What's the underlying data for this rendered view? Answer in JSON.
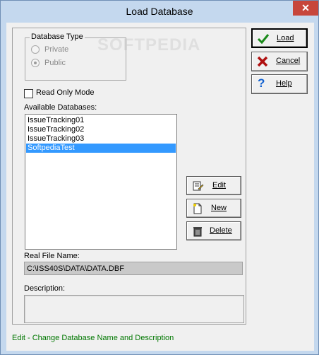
{
  "window": {
    "title": "Load Database",
    "close_glyph": "✕"
  },
  "watermark": "SOFTPEDIA",
  "db_type": {
    "legend": "Database Type",
    "options": [
      {
        "label": "Private",
        "selected": false
      },
      {
        "label": "Public",
        "selected": true
      }
    ]
  },
  "read_only": {
    "label": "Read Only Mode",
    "checked": false
  },
  "available": {
    "label": "Available Databases:",
    "items": [
      "IssueTracking01",
      "IssueTracking02",
      "IssueTracking03",
      "SoftpediaTest"
    ],
    "selected_index": 3
  },
  "side_buttons": {
    "edit": "Edit",
    "new": "New",
    "delete": "Delete"
  },
  "buttons": {
    "load": "Load",
    "cancel": "Cancel",
    "help": "Help"
  },
  "real_file": {
    "label": "Real File Name:",
    "value": "C:\\ISS40S\\DATA\\DATA.DBF"
  },
  "description": {
    "label": "Description:",
    "value": ""
  },
  "status": "Edit - Change Database Name and Description",
  "colors": {
    "accent_selected": "#3399ff",
    "status_text": "#007700",
    "close_bg": "#c7463b",
    "frame": "#c4d8ee"
  },
  "icons": [
    "checkmark-icon",
    "x-icon",
    "question-icon",
    "edit-document-icon",
    "new-document-icon",
    "trash-icon"
  ]
}
